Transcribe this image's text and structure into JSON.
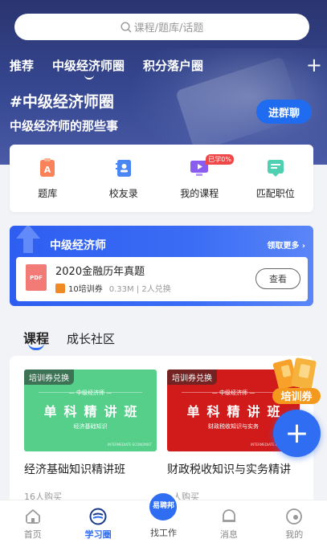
{
  "search": {
    "placeholder": "课程/题库/话题",
    "icon": "search-icon"
  },
  "top_tabs": [
    {
      "label": "推荐",
      "active": false
    },
    {
      "label": "中级经济师圈",
      "active": true
    },
    {
      "label": "积分落户圈",
      "active": false
    }
  ],
  "circle": {
    "title": "#中级经济师圈",
    "subtitle": "中级经济师的那些事",
    "join_label": "进群聊"
  },
  "quick_menu": [
    {
      "label": "题库",
      "icon": "question-bank-icon"
    },
    {
      "label": "校友录",
      "icon": "alumni-book-icon"
    },
    {
      "label": "我的课程",
      "icon": "my-course-icon",
      "badge": "已学0%"
    },
    {
      "label": "匹配职位",
      "icon": "job-match-icon"
    }
  ],
  "promo": {
    "title": "中级经济师",
    "more_label": "领取更多",
    "doc": {
      "type": "PDF",
      "title": "2020金融历年真题",
      "cost": "10培训券",
      "meta": "0.33M | 2人兑换",
      "view_label": "查看"
    }
  },
  "section_tabs": [
    {
      "label": "课程",
      "active": true
    },
    {
      "label": "成长社区",
      "active": false
    }
  ],
  "courses": [
    {
      "tag": "培训券兑换",
      "cover_small": "— 中级经济师 —",
      "cover_big": "单科精讲班",
      "cover_sub": "经济基础知识",
      "cover_eng": "INTERMEDIATE ECONOMIST",
      "title": "经济基础知识精讲班",
      "buyers": "16人购买",
      "cover_color": "#55cf8a"
    },
    {
      "tag": "培训券兑换",
      "cover_small": "— 中级经济师 —",
      "cover_big": "单科精讲班",
      "cover_sub": "财政税收知识与实务",
      "cover_eng": "INTERMEDIATE ECONOMIST",
      "title": "财政税收知识与实务精讲",
      "buyers": "1人购买",
      "cover_color": "#d11b1b"
    }
  ],
  "floating": {
    "voucher_label": "培训券",
    "fab_icon": "plus-icon"
  },
  "bottom_nav": [
    {
      "label": "首页",
      "icon": "home-icon",
      "active": false
    },
    {
      "label": "学习圈",
      "icon": "study-circle-icon",
      "active": true
    },
    {
      "label": "找工作",
      "icon": "find-job-icon",
      "active": false,
      "badge": "易聘邦"
    },
    {
      "label": "消息",
      "icon": "message-icon",
      "active": false
    },
    {
      "label": "我的",
      "icon": "profile-icon",
      "active": false
    }
  ],
  "colors": {
    "accent": "#2f6df2",
    "hero": "#364791",
    "red_badge": "#f04848"
  }
}
